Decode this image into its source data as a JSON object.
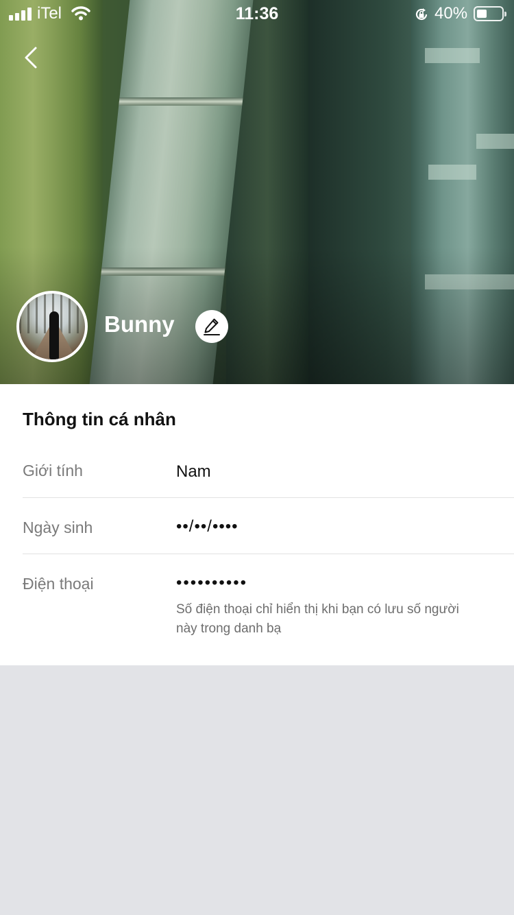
{
  "status_bar": {
    "carrier": "iTel",
    "time": "11:36",
    "battery_percent": "40%",
    "battery_level": 0.4
  },
  "header": {
    "back_icon": "chevron-left-icon",
    "profile_name": "Bunny",
    "edit_icon": "pencil-icon"
  },
  "personal_info": {
    "title": "Thông tin cá nhân",
    "fields": [
      {
        "label": "Giới tính",
        "value": "Nam"
      },
      {
        "label": "Ngày sinh",
        "value": "••/••/••••"
      },
      {
        "label": "Điện thoại",
        "value": "••••••••••",
        "note": "Số điện thoại chỉ hiển thị khi bạn có lưu số người này trong danh bạ"
      }
    ]
  },
  "colors": {
    "card_background": "#ffffff",
    "page_background": "#e2e3e7",
    "label_text": "#7a7a7a",
    "value_text": "#111111"
  }
}
